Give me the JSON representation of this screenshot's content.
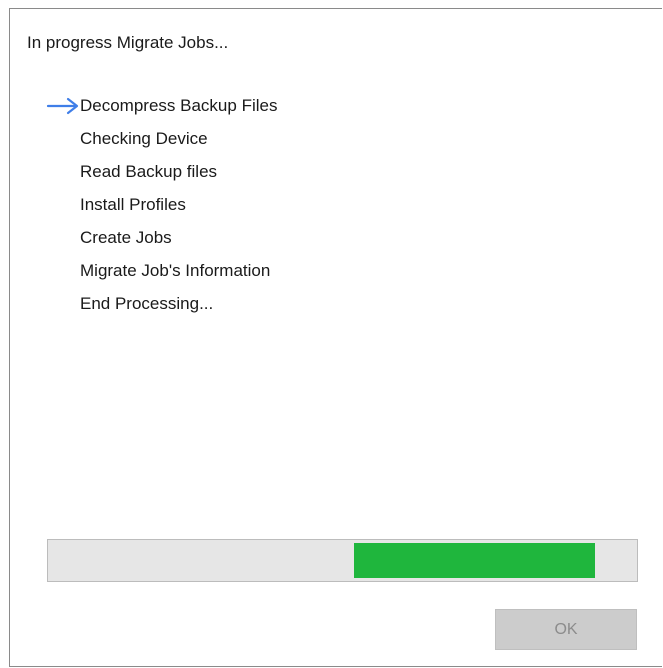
{
  "dialog": {
    "heading": "In progress Migrate Jobs...",
    "current_step_index": 0,
    "steps": [
      {
        "label": "Decompress Backup Files",
        "current": true
      },
      {
        "label": "Checking Device",
        "current": false
      },
      {
        "label": "Read Backup files",
        "current": false
      },
      {
        "label": "Install Profiles",
        "current": false
      },
      {
        "label": "Create Jobs",
        "current": false
      },
      {
        "label": "Migrate Job's Information",
        "current": false
      },
      {
        "label": "End Processing...",
        "current": false
      }
    ],
    "progress": {
      "segment_start_fraction": 0.52,
      "segment_end_fraction": 0.93
    },
    "ok_button": {
      "label": "OK",
      "enabled": false
    }
  },
  "colors": {
    "progress_fill": "#1fb63d",
    "progress_track": "#e6e6e6",
    "current_step_arrow": "#3f7ee8",
    "disabled_button_bg": "#cccccc",
    "disabled_button_text": "#8c8c8c"
  },
  "icons": {
    "current_step": "right-arrow-icon"
  }
}
